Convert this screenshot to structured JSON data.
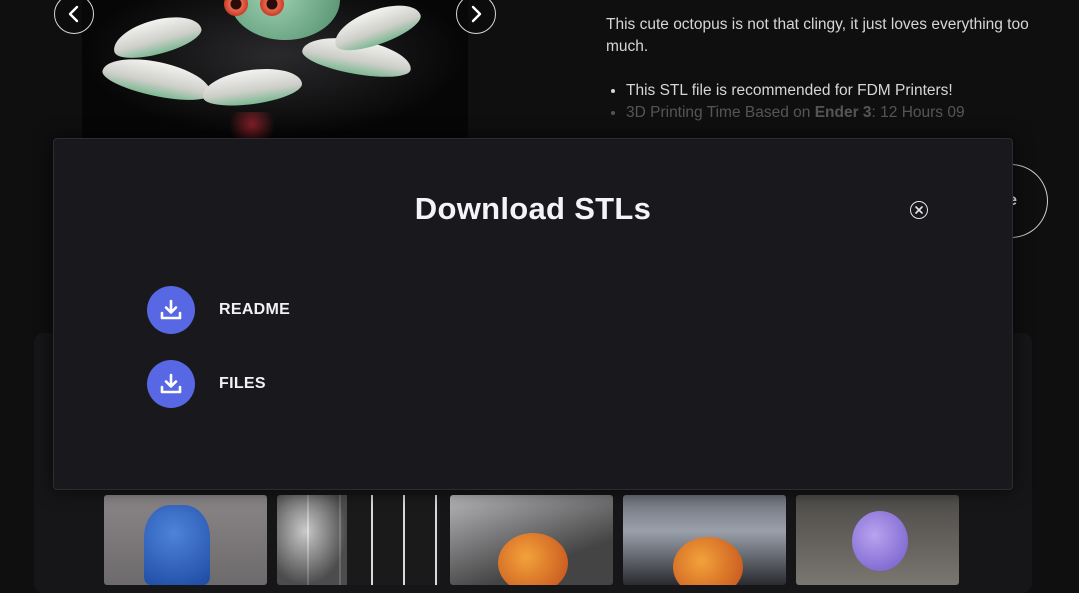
{
  "gallery": {
    "prev_icon": "chevron-left-icon",
    "next_icon": "chevron-right-icon"
  },
  "description": {
    "intro": "This cute octopus is not that clingy, it just loves everything too much.",
    "bullets": [
      "This STL file is recommended for FDM Printers!",
      "3D Printing Time Based on "
    ],
    "print_time_printer": "Ender 3",
    "print_time_value": ": 12 Hours 09"
  },
  "background_button": {
    "visible_text": "e"
  },
  "modal": {
    "title": "Download STLs",
    "close_icon": "close-circle-icon",
    "items": [
      {
        "label": "README",
        "icon": "download-icon"
      },
      {
        "label": "FILES",
        "icon": "download-icon"
      }
    ]
  },
  "colors": {
    "accent": "#5867e3",
    "modal_bg": "#19191d",
    "page_bg": "#0f0f10"
  }
}
